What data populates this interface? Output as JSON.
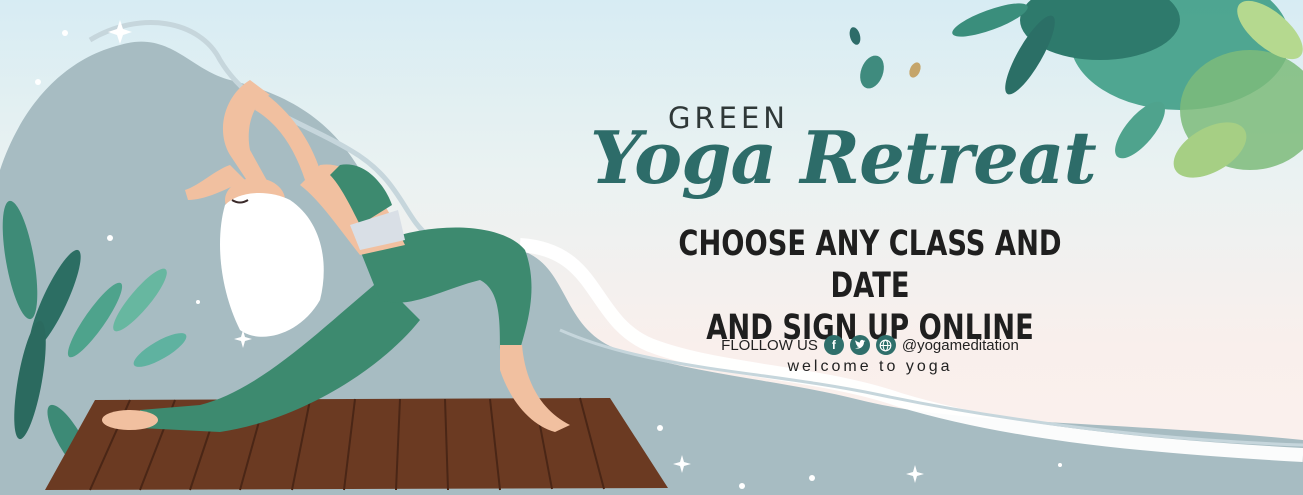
{
  "brand": {
    "top_word": "GREEN",
    "title_script": "Yoga Retreat"
  },
  "headline": {
    "line1": "CHOOSE ANY CLASS AND DATE",
    "line2": "AND SIGN UP ONLINE"
  },
  "social": {
    "follow_label": "FLOLLOW US",
    "handle": "@yogameditation",
    "icons": [
      "facebook-icon",
      "twitter-icon",
      "globe-icon"
    ]
  },
  "tagline": "welcome to yoga",
  "colors": {
    "accent_green": "#2d6c69",
    "legging_green": "#3d8a6f",
    "mat_brown": "#6b3a22",
    "backdrop_blue": "#a7bcc2"
  }
}
